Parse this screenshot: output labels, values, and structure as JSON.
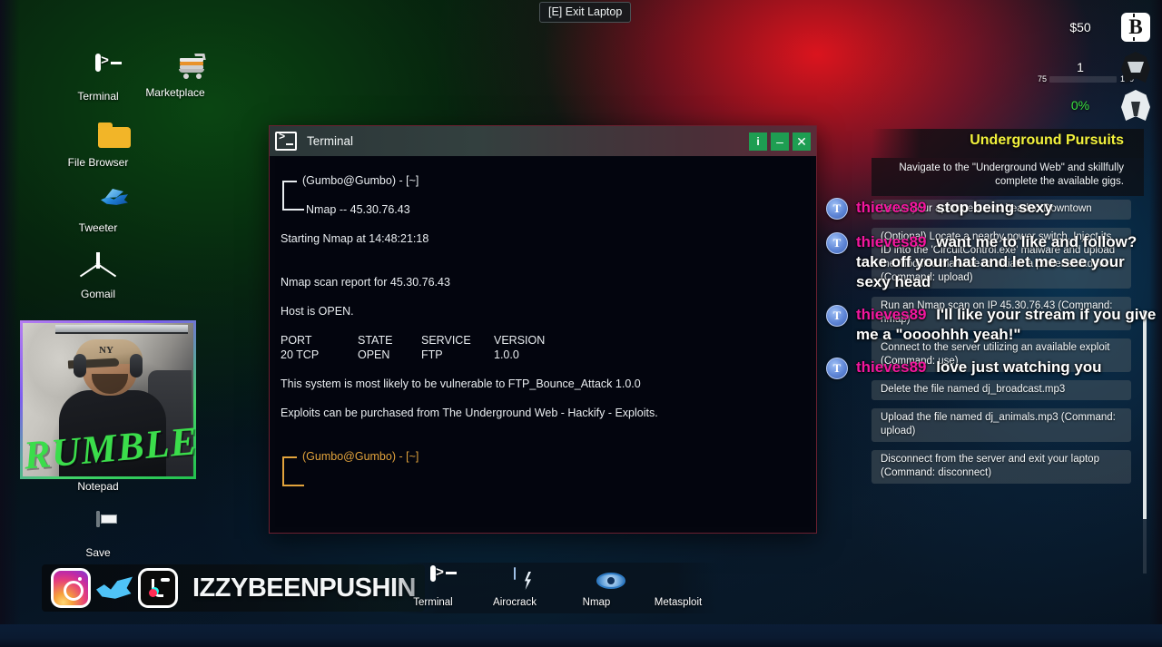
{
  "top": {
    "exit_laptop_label": "[E] Exit Laptop"
  },
  "hud": {
    "money": "$50",
    "level": "1",
    "xp_min": "75",
    "xp_max": "100",
    "xp_percent_fill": 75,
    "heat": "0%",
    "bitcoin_icon": "B",
    "icons": [
      "bitcoin-icon",
      "hooded-figure-icon",
      "ghost-figure-icon"
    ]
  },
  "desktop_icons": [
    {
      "label": "Terminal",
      "icon": "terminal-icon"
    },
    {
      "label": "Marketplace",
      "icon": "shopping-cart-icon"
    },
    {
      "label": "File Browser",
      "icon": "folder-icon"
    },
    {
      "label": "Tweeter",
      "icon": "bird-icon"
    },
    {
      "label": "Gomail",
      "icon": "envelope-icon"
    },
    {
      "label": "Notepad",
      "icon": "notepad-icon"
    },
    {
      "label": "Save",
      "icon": "floppy-disk-icon"
    }
  ],
  "terminal": {
    "title": "Terminal",
    "buttons": {
      "info": "i",
      "minimize": "–",
      "close": "✕"
    },
    "lines": {
      "prompt1_user": "(Gumbo@Gumbo) - [~]",
      "prompt1_cmd": "Nmap -- 45.30.76.43",
      "starting": "Starting Nmap at 14:48:21:18",
      "report": "Nmap scan report for 45.30.76.43",
      "host": "Host is OPEN.",
      "table_head": {
        "port": "PORT",
        "state": "STATE",
        "service": "SERVICE",
        "version": "VERSION"
      },
      "table_row": {
        "port": "20 TCP",
        "state": "OPEN",
        "service": "FTP",
        "version": "1.0.0"
      },
      "vuln": "This system is most likely to be vulnerable to FTP_Bounce_Attack 1.0.0",
      "exploits": "Exploits can be purchased from The Underground Web - Hackify - Exploits.",
      "prompt2_user": "(Gumbo@Gumbo) - [~]"
    }
  },
  "quest": {
    "title": "Underground Pursuits",
    "description": "Navigate to the \"Underground Web\" and skillfully complete the available gigs.",
    "items": [
      "Leave your apartment and head to Downtown",
      "(Optional) Locate a nearby power switch. Inject its ID into the 'CircuitControl.exe' malware and upload the modified malware to initiate a power shutdown. (Command: upload)",
      "Run an Nmap scan on IP 45.30.76.43 (Command: nmap)",
      "Connect to the server utilizing an available exploit (Command: use)",
      "Delete the file named dj_broadcast.mp3",
      "Upload the file named dj_animals.mp3 (Command: upload)",
      "Disconnect from the server and exit your laptop (Command: disconnect)"
    ]
  },
  "chat": {
    "messages": [
      {
        "avatar": "T",
        "user": "thieves89",
        "text": "stop being sexy"
      },
      {
        "avatar": "T",
        "user": "thieves89",
        "text": "want me to like and follow? take off your hat and let me see your sexy head"
      },
      {
        "avatar": "T",
        "user": "thieves89",
        "text": "I'll like your stream if you give me a \"oooohhh yeah!\""
      },
      {
        "avatar": "T",
        "user": "thieves89",
        "text": "love just watching you"
      }
    ],
    "user_color": "#f3179f"
  },
  "overlay": {
    "handle": "IZZYBEENPUSHIN",
    "watermark": "RUMBLE",
    "socials": [
      "instagram-icon",
      "twitter-icon",
      "tiktok-icon"
    ]
  },
  "taskbar": [
    {
      "label": "Terminal",
      "icon": "terminal-icon"
    },
    {
      "label": "Airocrack",
      "icon": "airocrack-icon"
    },
    {
      "label": "Nmap",
      "icon": "eye-icon"
    },
    {
      "label": "Metasploit",
      "icon": "shield-m-icon"
    }
  ],
  "colors": {
    "accent_green": "#1e9e52",
    "quest_title": "#f3f23c",
    "chat_user": "#f3179f",
    "heat_green": "#39e03d",
    "rumble_green": "#3bdd4b"
  }
}
